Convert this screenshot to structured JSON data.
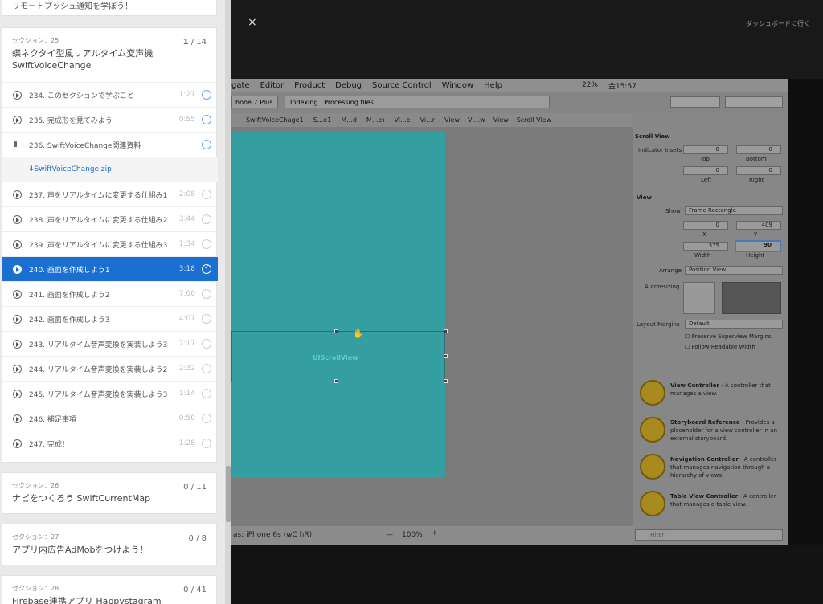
{
  "sidebar": {
    "top_card_title": "リモートプッシュ通知を学ぼう！",
    "section25": {
      "label": "セクション：25",
      "count_current": "1",
      "count_total": " / 14",
      "title": "蝶ネクタイ型風リアルタイム変声機 SwiftVoiceChange",
      "lectures": [
        {
          "title": "234. このセクションで学ぶこと",
          "dur": "1:27"
        },
        {
          "title": "235. 完成形を見てみよう",
          "dur": "0:55"
        },
        {
          "title": "236. SwiftVoiceChange関連資料",
          "dur": ""
        },
        {
          "title": "237. 声をリアルタイムに変更する仕組み1",
          "dur": "2:08"
        },
        {
          "title": "238. 声をリアルタイムに変更する仕組み2",
          "dur": "3:44"
        },
        {
          "title": "239. 声をリアルタイムに変更する仕組み3",
          "dur": "1:34"
        },
        {
          "title": "240. 画面を作成しよう1",
          "dur": "3:18"
        },
        {
          "title": "241. 画面を作成しよう2",
          "dur": "7:00"
        },
        {
          "title": "242. 画面を作成しよう3",
          "dur": "4:07"
        },
        {
          "title": "243. リアルタイム音声変換を実装しよう3",
          "dur": "7:17"
        },
        {
          "title": "244. リアルタイム音声変換を実装しよう2",
          "dur": "2:32"
        },
        {
          "title": "245. リアルタイム音声変換を実装しよう3",
          "dur": "1:14"
        },
        {
          "title": "246. 補足事項",
          "dur": "0:50"
        },
        {
          "title": "247. 完成！",
          "dur": "1:28"
        }
      ],
      "zip": "SwiftVoiceChange.zip"
    },
    "section26": {
      "label": "セクション：26",
      "count": "0 / 11",
      "title": "ナビをつくろう SwiftCurrentMap"
    },
    "section27": {
      "label": "セクション：27",
      "count": "0 / 8",
      "title": "アプリ内広告AdMobをつけよう！"
    },
    "section28": {
      "label": "セクション：28",
      "count": "0 / 41",
      "title": "Firebase連携アプリ Happystagram"
    }
  },
  "header": {
    "close": "×",
    "dashboard": "ダッシュボードに行く"
  },
  "video": {
    "menubar": [
      "gate",
      "Editor",
      "Product",
      "Debug",
      "Source Control",
      "Window",
      "Help"
    ],
    "status": {
      "battery": "22%",
      "time": "金15:57"
    },
    "scheme": "hone 7 Plus",
    "activity": "Indexing | Processing files",
    "crumbs": [
      "SwiftVoiceChage1",
      "S...e1",
      "M...d",
      "M...e)",
      "Vi...e",
      "Vi...r",
      "View",
      "Vi...w",
      "View",
      "Scroll View"
    ],
    "canvas_label": "UIScrollView",
    "bottom": {
      "device": "as: iPhone 6s (wC hR)",
      "zoom": "100%"
    },
    "inspector": {
      "scroll_view": "Scroll View",
      "indicator_insets": "Indicator Insets",
      "top": "Top",
      "bottom": "Bottom",
      "left": "Left",
      "right": "Right",
      "inset_values": [
        "0",
        "0",
        "0",
        "0"
      ],
      "view": "View",
      "show_label": "Show",
      "show_value": "Frame Rectangle",
      "x": "0",
      "y": "409",
      "width": "375",
      "height": "90",
      "x_label": "X",
      "y_label": "Y",
      "w_label": "Width",
      "h_label": "Height",
      "arrange": "Arrange",
      "arrange_value": "Position View",
      "autoresizing": "Autoresizing",
      "layout_margins": "Layout Margins",
      "layout_value": "Default",
      "preserve": "Preserve Superview Margins",
      "follow": "Follow Readable Width",
      "library": [
        {
          "name": "View Controller",
          "desc": " - A controller that manages a view."
        },
        {
          "name": "Storyboard Reference",
          "desc": " - Provides a placeholder for a view controller in an external storyboard."
        },
        {
          "name": "Navigation Controller",
          "desc": " - A controller that manages navigation through a hierarchy of views."
        },
        {
          "name": "Table View Controller",
          "desc": " - A controller that manages a table view."
        }
      ],
      "filter": "Filter"
    }
  }
}
